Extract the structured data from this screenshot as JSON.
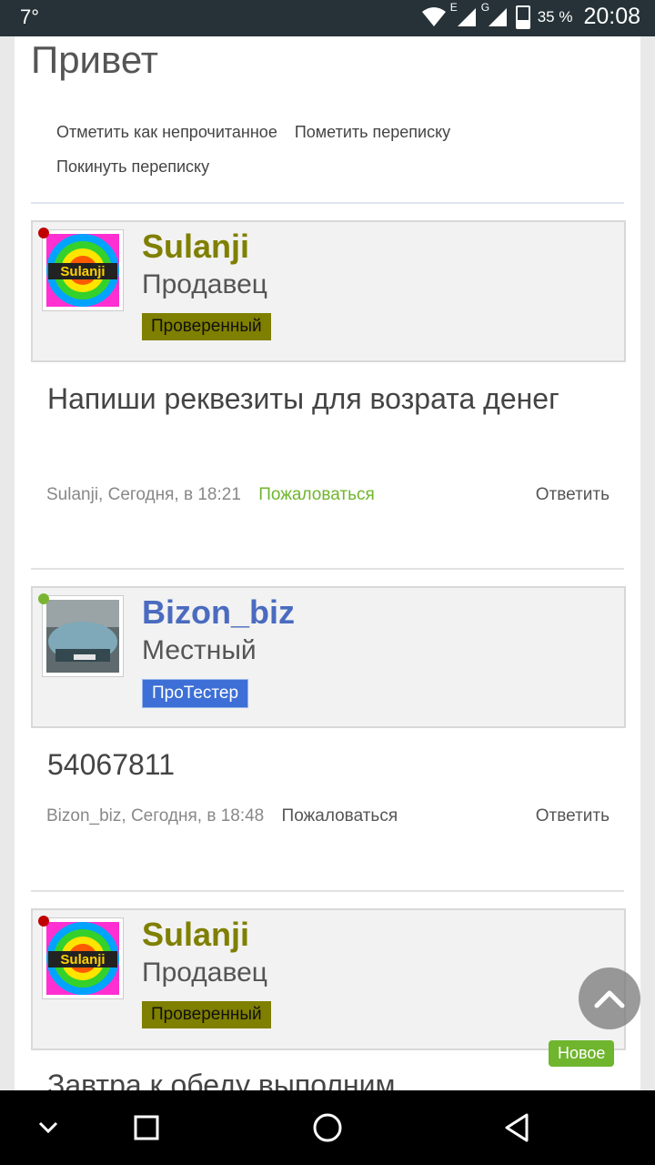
{
  "status_bar": {
    "temperature": "7°",
    "network_label_1": "E",
    "network_label_2": "G",
    "battery": "35 %",
    "time": "20:08"
  },
  "conversation": {
    "title": "Привет",
    "actions": [
      "Отметить как непрочитанное",
      "Пометить переписку",
      "Покинуть переписку"
    ]
  },
  "messages": [
    {
      "username": "Sulanji",
      "username_color": "#7f7f00",
      "online_color": "#c00000",
      "role": "Продавец",
      "badge": "Проверенный",
      "badge_bg": "#7f7f00",
      "badge_fg": "#111111",
      "avatar_text": "Sulanji",
      "text": "Напиши реквезиты для возрата денег",
      "author": "Sulanji",
      "date": "Сегодня, в 18:21",
      "report": "Пожаловаться",
      "report_color": "#6fb52d",
      "reply": "Ответить"
    },
    {
      "username": "Bizon_biz",
      "username_color": "#4a6bbf",
      "online_color": "#7ab531",
      "role": "Местный",
      "badge": "ПроТестер",
      "badge_bg": "#3d6fd6",
      "badge_fg": "#ffffff",
      "text": "54067811",
      "author": "Bizon_biz",
      "date": "Сегодня, в 18:48",
      "report": "Пожаловаться",
      "report_color": "#555555",
      "reply": "Ответить"
    },
    {
      "username": "Sulanji",
      "username_color": "#7f7f00",
      "online_color": "#c00000",
      "role": "Продавец",
      "badge": "Проверенный",
      "badge_bg": "#7f7f00",
      "badge_fg": "#111111",
      "avatar_text": "Sulanji",
      "text": "Завтра к обеду выполним",
      "new_label": "Новое"
    }
  ],
  "nav_icons": [
    "chevron-down-icon",
    "recent-apps-icon",
    "home-icon",
    "back-icon"
  ]
}
